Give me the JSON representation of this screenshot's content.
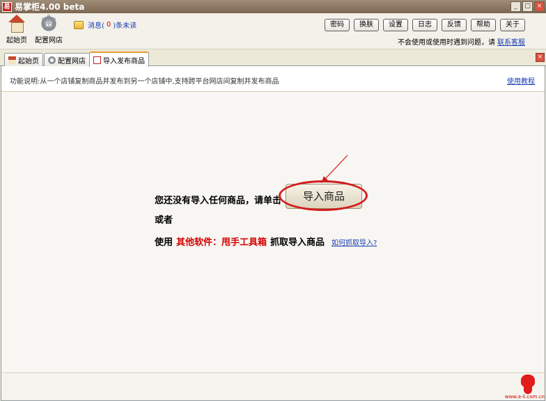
{
  "window": {
    "app_icon_char": "易",
    "title": "易掌柜4.00 beta",
    "minimize": "_",
    "maximize": "□",
    "close": "×"
  },
  "toolbar": {
    "home_label": "起始页",
    "config_label": "配置网店",
    "msg_prefix": "消息(",
    "msg_count": "0",
    "msg_suffix": ")条未读",
    "buttons": [
      "密码",
      "换肤",
      "设置",
      "日志",
      "反馈",
      "帮助",
      "关于"
    ],
    "help_text": "不会使用或使用时遇到问题，请",
    "help_link": "联系客服"
  },
  "tabs": [
    {
      "label": "起始页"
    },
    {
      "label": "配置网店"
    },
    {
      "label": "导入发布商品"
    }
  ],
  "tab_close": "×",
  "content": {
    "func_desc": "功能说明:从一个店铺复制商品并发布到另一个店铺中,支持跨平台网店间复制并发布商品",
    "tutorial_link": "使用教程",
    "line1": "您还没有导入任何商品，请单击",
    "import_button": "导入商品",
    "line2": "或者",
    "line3_prefix": "使用",
    "line3_red": "其他软件：甩手工具箱",
    "line3_suffix": "抓取导入商品",
    "how_link": "如何抓取导入?"
  },
  "footer": {
    "watermark": "www.a-li.com.cn"
  },
  "colors": {
    "accent_red": "#d40000",
    "link_blue": "#1a3fb0",
    "highlight_ellipse": "#d21d1d"
  }
}
